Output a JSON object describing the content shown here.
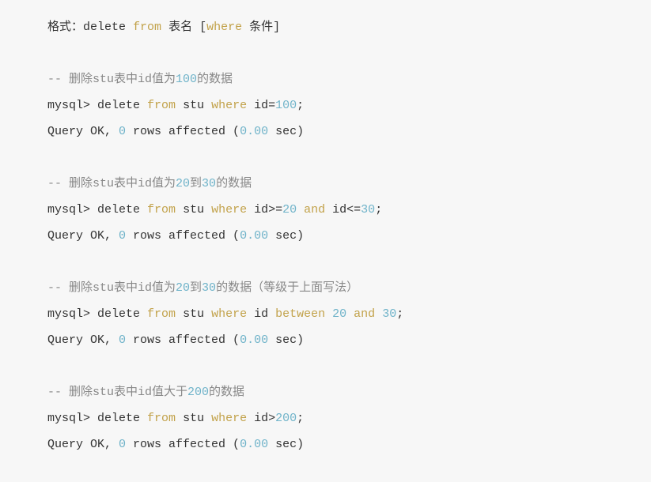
{
  "lines": [
    {
      "segments": [
        {
          "t": "格式：",
          "c": "tok-default"
        },
        {
          "t": "delete",
          "c": "tok-default"
        },
        {
          "t": " ",
          "c": "tok-default"
        },
        {
          "t": "from",
          "c": "tok-keyword"
        },
        {
          "t": " 表名 [",
          "c": "tok-default"
        },
        {
          "t": "where",
          "c": "tok-keyword"
        },
        {
          "t": " 条件]",
          "c": "tok-default"
        }
      ]
    },
    {
      "segments": [
        {
          "t": " ",
          "c": "tok-default"
        }
      ]
    },
    {
      "segments": [
        {
          "t": "-- 删除stu表中id值为",
          "c": "tok-comment"
        },
        {
          "t": "100",
          "c": "tok-number"
        },
        {
          "t": "的数据",
          "c": "tok-comment"
        }
      ]
    },
    {
      "segments": [
        {
          "t": "mysql> ",
          "c": "tok-default"
        },
        {
          "t": "delete",
          "c": "tok-default"
        },
        {
          "t": " ",
          "c": "tok-default"
        },
        {
          "t": "from",
          "c": "tok-keyword"
        },
        {
          "t": " stu ",
          "c": "tok-default"
        },
        {
          "t": "where",
          "c": "tok-keyword"
        },
        {
          "t": " id=",
          "c": "tok-default"
        },
        {
          "t": "100",
          "c": "tok-number"
        },
        {
          "t": ";",
          "c": "tok-default"
        }
      ]
    },
    {
      "segments": [
        {
          "t": "Query OK, ",
          "c": "tok-default"
        },
        {
          "t": "0",
          "c": "tok-number"
        },
        {
          "t": " rows affected (",
          "c": "tok-default"
        },
        {
          "t": "0.00",
          "c": "tok-number"
        },
        {
          "t": " sec)",
          "c": "tok-default"
        }
      ]
    },
    {
      "segments": [
        {
          "t": " ",
          "c": "tok-default"
        }
      ]
    },
    {
      "segments": [
        {
          "t": "-- 删除stu表中id值为",
          "c": "tok-comment"
        },
        {
          "t": "20",
          "c": "tok-number"
        },
        {
          "t": "到",
          "c": "tok-comment"
        },
        {
          "t": "30",
          "c": "tok-number"
        },
        {
          "t": "的数据",
          "c": "tok-comment"
        }
      ]
    },
    {
      "segments": [
        {
          "t": "mysql> ",
          "c": "tok-default"
        },
        {
          "t": "delete",
          "c": "tok-default"
        },
        {
          "t": " ",
          "c": "tok-default"
        },
        {
          "t": "from",
          "c": "tok-keyword"
        },
        {
          "t": " stu ",
          "c": "tok-default"
        },
        {
          "t": "where",
          "c": "tok-keyword"
        },
        {
          "t": " id>=",
          "c": "tok-default"
        },
        {
          "t": "20",
          "c": "tok-number"
        },
        {
          "t": " ",
          "c": "tok-default"
        },
        {
          "t": "and",
          "c": "tok-keyword"
        },
        {
          "t": " id<=",
          "c": "tok-default"
        },
        {
          "t": "30",
          "c": "tok-number"
        },
        {
          "t": ";",
          "c": "tok-default"
        }
      ]
    },
    {
      "segments": [
        {
          "t": "Query OK, ",
          "c": "tok-default"
        },
        {
          "t": "0",
          "c": "tok-number"
        },
        {
          "t": " rows affected (",
          "c": "tok-default"
        },
        {
          "t": "0.00",
          "c": "tok-number"
        },
        {
          "t": " sec)",
          "c": "tok-default"
        }
      ]
    },
    {
      "segments": [
        {
          "t": " ",
          "c": "tok-default"
        }
      ]
    },
    {
      "segments": [
        {
          "t": "-- 删除stu表中id值为",
          "c": "tok-comment"
        },
        {
          "t": "20",
          "c": "tok-number"
        },
        {
          "t": "到",
          "c": "tok-comment"
        },
        {
          "t": "30",
          "c": "tok-number"
        },
        {
          "t": "的数据（等级于上面写法）",
          "c": "tok-comment"
        }
      ]
    },
    {
      "segments": [
        {
          "t": "mysql> ",
          "c": "tok-default"
        },
        {
          "t": "delete",
          "c": "tok-default"
        },
        {
          "t": " ",
          "c": "tok-default"
        },
        {
          "t": "from",
          "c": "tok-keyword"
        },
        {
          "t": " stu ",
          "c": "tok-default"
        },
        {
          "t": "where",
          "c": "tok-keyword"
        },
        {
          "t": " id ",
          "c": "tok-default"
        },
        {
          "t": "between",
          "c": "tok-keyword"
        },
        {
          "t": " ",
          "c": "tok-default"
        },
        {
          "t": "20",
          "c": "tok-number"
        },
        {
          "t": " ",
          "c": "tok-default"
        },
        {
          "t": "and",
          "c": "tok-keyword"
        },
        {
          "t": " ",
          "c": "tok-default"
        },
        {
          "t": "30",
          "c": "tok-number"
        },
        {
          "t": ";",
          "c": "tok-default"
        }
      ]
    },
    {
      "segments": [
        {
          "t": "Query OK, ",
          "c": "tok-default"
        },
        {
          "t": "0",
          "c": "tok-number"
        },
        {
          "t": " rows affected (",
          "c": "tok-default"
        },
        {
          "t": "0.00",
          "c": "tok-number"
        },
        {
          "t": " sec)",
          "c": "tok-default"
        }
      ]
    },
    {
      "segments": [
        {
          "t": " ",
          "c": "tok-default"
        }
      ]
    },
    {
      "segments": [
        {
          "t": "-- 删除stu表中id值大于",
          "c": "tok-comment"
        },
        {
          "t": "200",
          "c": "tok-number"
        },
        {
          "t": "的数据",
          "c": "tok-comment"
        }
      ]
    },
    {
      "segments": [
        {
          "t": "mysql> ",
          "c": "tok-default"
        },
        {
          "t": "delete",
          "c": "tok-default"
        },
        {
          "t": " ",
          "c": "tok-default"
        },
        {
          "t": "from",
          "c": "tok-keyword"
        },
        {
          "t": " stu ",
          "c": "tok-default"
        },
        {
          "t": "where",
          "c": "tok-keyword"
        },
        {
          "t": " id>",
          "c": "tok-default"
        },
        {
          "t": "200",
          "c": "tok-number"
        },
        {
          "t": ";",
          "c": "tok-default"
        }
      ]
    },
    {
      "segments": [
        {
          "t": "Query OK, ",
          "c": "tok-default"
        },
        {
          "t": "0",
          "c": "tok-number"
        },
        {
          "t": " rows affected (",
          "c": "tok-default"
        },
        {
          "t": "0.00",
          "c": "tok-number"
        },
        {
          "t": " sec)",
          "c": "tok-default"
        }
      ]
    }
  ]
}
